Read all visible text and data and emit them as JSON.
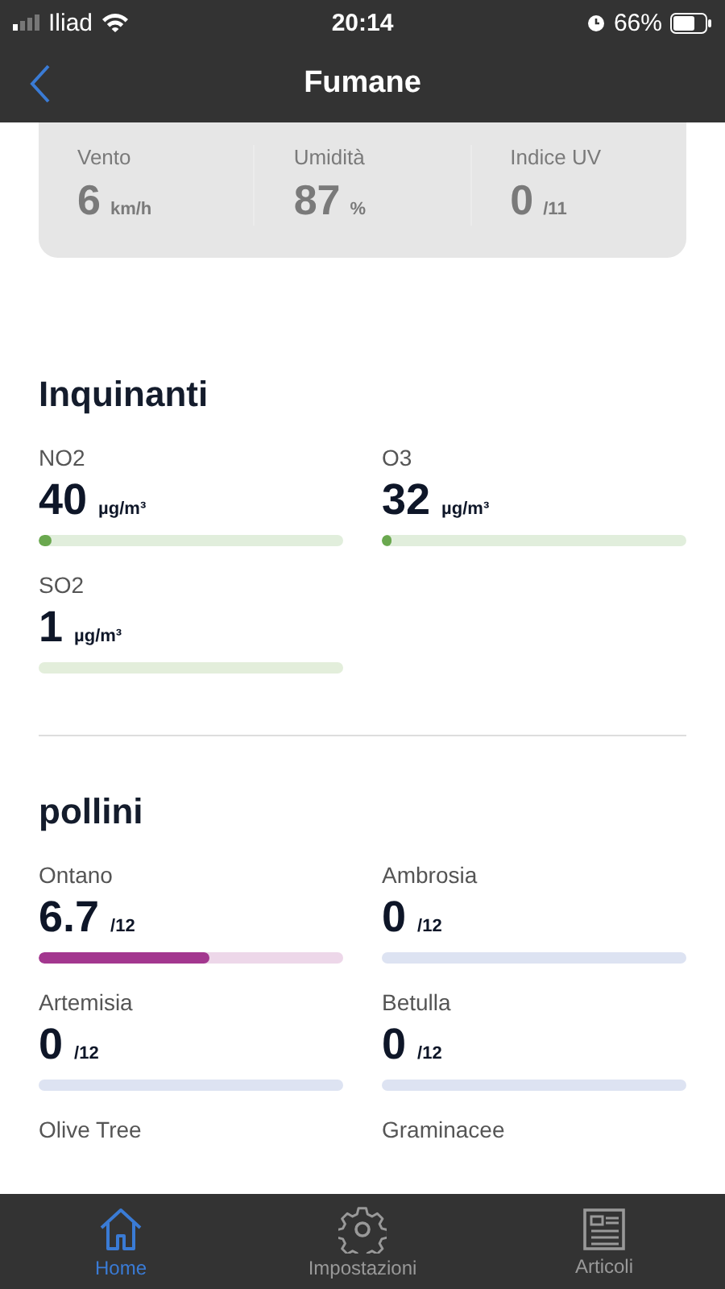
{
  "status_bar": {
    "carrier": "Iliad",
    "time": "20:14",
    "battery": "66%"
  },
  "nav": {
    "title": "Fumane"
  },
  "weather": [
    {
      "label": "Vento",
      "value": "6",
      "unit": "km/h"
    },
    {
      "label": "Umidità",
      "value": "87",
      "unit": "%"
    },
    {
      "label": "Indice UV",
      "value": "0",
      "unit": "/11"
    }
  ],
  "pollutants": {
    "title": "Inquinanti",
    "items": [
      {
        "name": "NO2",
        "value": "40",
        "unit": "µg/m³",
        "level": 0.04,
        "color": "#6aa84f"
      },
      {
        "name": "O3",
        "value": "32",
        "unit": "µg/m³",
        "level": 0.02,
        "color": "#6aa84f"
      },
      {
        "name": "SO2",
        "value": "1",
        "unit": "µg/m³",
        "color": "#e3eedb"
      }
    ]
  },
  "pollen": {
    "title": "pollini",
    "items": [
      {
        "name": "Ontano",
        "value": "6.7",
        "unit": "/12",
        "level": 0.56,
        "color": "#a3378f"
      },
      {
        "name": "Ambrosia",
        "value": "0",
        "unit": "/12",
        "color": "#dde3f2"
      },
      {
        "name": "Artemisia",
        "value": "0",
        "unit": "/12",
        "color": "#dde3f2"
      },
      {
        "name": "Betulla",
        "value": "0",
        "unit": "/12",
        "color": "#dde3f2"
      },
      {
        "name": "Olive Tree"
      },
      {
        "name": "Graminacee"
      }
    ]
  },
  "tabs": [
    {
      "label": "Home",
      "selected": true
    },
    {
      "label": "Impostazioni",
      "selected": false
    },
    {
      "label": "Articoli",
      "selected": false
    }
  ]
}
